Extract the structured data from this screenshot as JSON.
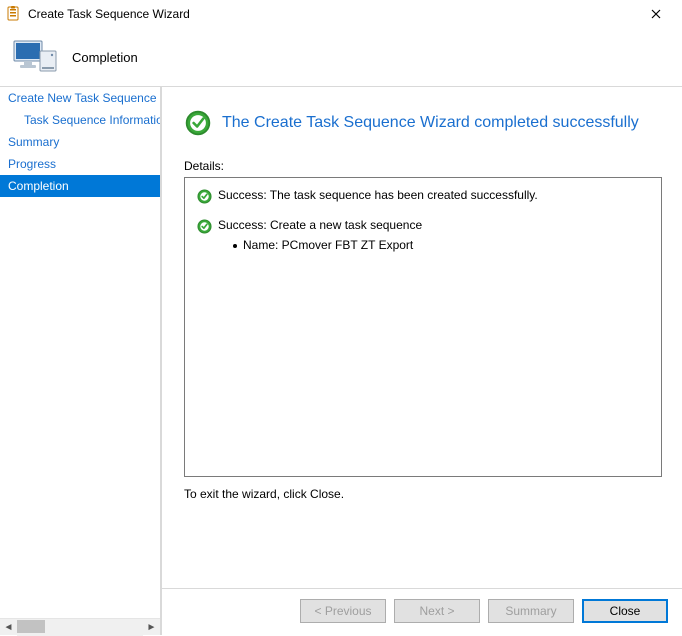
{
  "window": {
    "title": "Create Task Sequence Wizard"
  },
  "header": {
    "page_name": "Completion"
  },
  "sidebar": {
    "items": [
      {
        "label": "Create New Task Sequence",
        "indent": false,
        "active": false
      },
      {
        "label": "Task Sequence Information",
        "indent": true,
        "active": false
      },
      {
        "label": "Summary",
        "indent": false,
        "active": false
      },
      {
        "label": "Progress",
        "indent": false,
        "active": false
      },
      {
        "label": "Completion",
        "indent": false,
        "active": true
      }
    ]
  },
  "content": {
    "headline": "The Create Task Sequence Wizard completed successfully",
    "details_label": "Details:",
    "messages": [
      {
        "text": "Success: The task sequence has been created successfully.",
        "sub": []
      },
      {
        "text": "Success: Create a new task sequence",
        "sub": [
          "Name: PCmover FBT ZT Export"
        ]
      }
    ],
    "exit_hint": "To exit the wizard, click Close."
  },
  "footer": {
    "previous": "< Previous",
    "next": "Next >",
    "summary": "Summary",
    "close": "Close"
  }
}
